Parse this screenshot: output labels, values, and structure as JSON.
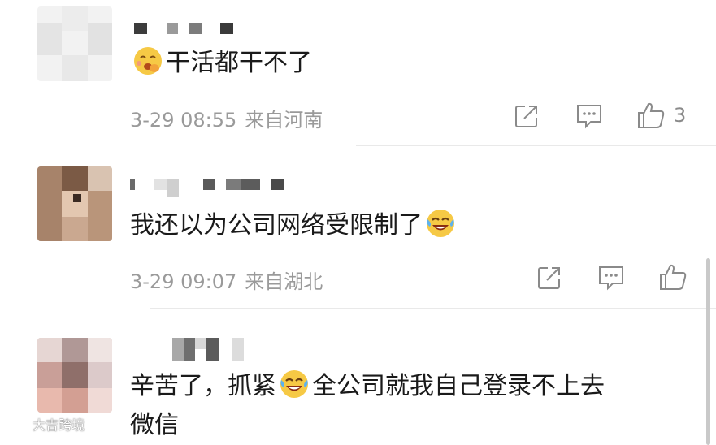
{
  "comments": [
    {
      "text_before": "",
      "text_after": "干活都干不了",
      "time": "3-29 08:55",
      "location": "来自河南",
      "like_count": "3",
      "emoji_lead": "worried-emoji"
    },
    {
      "text_before": "我还以为公司网络受限制了",
      "text_after": "",
      "time": "3-29 09:07",
      "location": "来自湖北",
      "like_count": "",
      "emoji_tail": "laugh-cry-emoji"
    },
    {
      "text_before": "辛苦了，抓紧",
      "text_after": "全公司就我自己登录不上去",
      "text_line2": "微信",
      "emoji_mid": "laugh-cry-emoji"
    }
  ],
  "icons": {
    "share": "share-icon",
    "reply": "comment-icon",
    "like": "thumbs-up-icon"
  },
  "watermark": {
    "text": "大吉跨境",
    "logo": "weibo-logo-icon"
  },
  "colors": {
    "text": "#1a1a1a",
    "meta": "#9a9a9a",
    "icon": "#8a8a8a"
  }
}
